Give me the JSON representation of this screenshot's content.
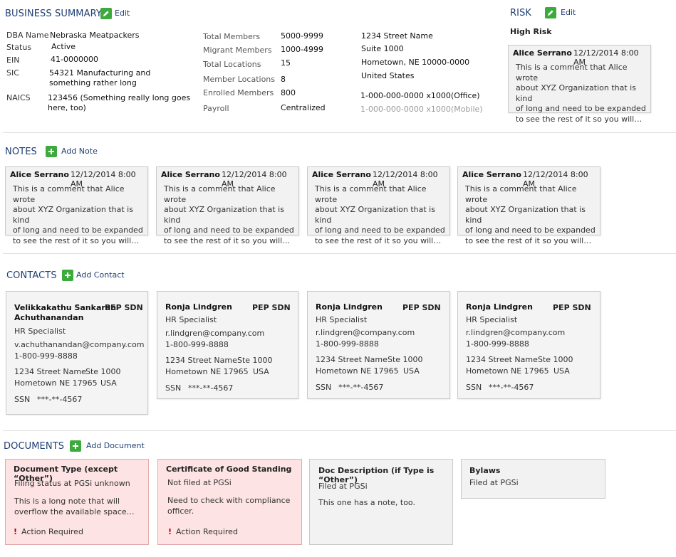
{
  "business": {
    "title": "BUSINESS SUMMARY",
    "edit_label": "Edit",
    "fields": {
      "dba_label": "DBA Name",
      "dba_value": "Nebraska Meatpackers",
      "status_label": "Status",
      "status_value": "Active",
      "ein_label": "EIN",
      "ein_value": "41-0000000",
      "sic_label": "SIC",
      "sic_value_1": "54321 Manufacturing and",
      "sic_value_2": "something rather long",
      "naics_label": "NAICS",
      "naics_value_1": "123456 (Something really long goes",
      "naics_value_2": "here, too)"
    },
    "stats": [
      {
        "label": "Total Members",
        "value": "5000-9999"
      },
      {
        "label": "Migrant Members",
        "value": "1000-4999"
      },
      {
        "label": "Total Locations",
        "value": "15"
      },
      {
        "label": "Member Locations",
        "value": "8"
      },
      {
        "label": "Enrolled Members",
        "value": "800"
      },
      {
        "label": "Payroll",
        "value": "Centralized"
      }
    ],
    "address": {
      "line1": "1234 Street Name",
      "line2": "Suite 1000",
      "line3": "Hometown, NE  10000-0000",
      "line4": "United States",
      "phone_office": "1-000-000-0000",
      "phone_office_ext": "x1000(Office)",
      "phone_mobile": "1-000-000-0000",
      "phone_mobile_ext": "x1000(Mobile)"
    }
  },
  "risk": {
    "title": "RISK",
    "edit_label": "Edit",
    "level": "High Risk",
    "comment": {
      "author": "Alice Serrano",
      "date": "12/12/2014 8:00 AM",
      "lines": [
        "This is a comment that Alice wrote",
        "about XYZ Organization that is kind",
        "of long and need to be expanded",
        "to see the rest of it so you will…"
      ]
    }
  },
  "notes": {
    "title": "NOTES",
    "add_label": "Add Note",
    "items": [
      {
        "author": "Alice Serrano",
        "date": "12/12/2014 8:00 AM",
        "lines": [
          "This is a comment that Alice wrote",
          "about XYZ Organization that is kind",
          "of long and need to be expanded",
          "to see the rest of it so you will…"
        ]
      },
      {
        "author": "Alice Serrano",
        "date": "12/12/2014 8:00 AM",
        "lines": [
          "This is a comment that Alice wrote",
          "about XYZ Organization that is kind",
          "of long and need to be expanded",
          "to see the rest of it so you will…"
        ]
      },
      {
        "author": "Alice Serrano",
        "date": "12/12/2014 8:00 AM",
        "lines": [
          "This is a comment that Alice wrote",
          "about XYZ Organization that is kind",
          "of long and need to be expanded",
          "to see the rest of it so you will…"
        ]
      },
      {
        "author": "Alice Serrano",
        "date": "12/12/2014 8:00 AM",
        "lines": [
          "This is a comment that Alice wrote",
          "about XYZ Organization that is kind",
          "of long and need to be expanded",
          "to see the rest of it so you will…"
        ]
      }
    ]
  },
  "contacts": {
    "title": "CONTACTS",
    "add_label": "Add Contact",
    "items": [
      {
        "name_1": "Velikkakathu Sankaran",
        "name_2": "Achuthanandan",
        "tag_pep": "PEP",
        "tag_sdn": "SDN",
        "role": "HR Specialist",
        "email": "v.achuthanandan@company.com",
        "phone": "1-800-999-8888",
        "street": "1234 Street Name",
        "suite": "Ste 1000",
        "city": "Hometown NE  17965",
        "country": "USA",
        "ssn_label": "SSN",
        "ssn": "***-**-4567"
      },
      {
        "name_1": "Ronja Lindgren",
        "name_2": "",
        "tag_pep": "PEP",
        "tag_sdn": "SDN",
        "role": "HR Specialist",
        "email": "r.lindgren@company.com",
        "phone": "1-800-999-8888",
        "street": "1234 Street Name",
        "suite": "Ste 1000",
        "city": "Hometown NE  17965",
        "country": "USA",
        "ssn_label": "SSN",
        "ssn": "***-**-4567"
      },
      {
        "name_1": "Ronja Lindgren",
        "name_2": "",
        "tag_pep": "PEP",
        "tag_sdn": "SDN",
        "role": "HR Specialist",
        "email": "r.lindgren@company.com",
        "phone": "1-800-999-8888",
        "street": "1234 Street Name",
        "suite": "Ste 1000",
        "city": "Hometown NE  17965",
        "country": "USA",
        "ssn_label": "SSN",
        "ssn": "***-**-4567"
      },
      {
        "name_1": "Ronja Lindgren",
        "name_2": "",
        "tag_pep": "PEP",
        "tag_sdn": "SDN",
        "role": "HR Specialist",
        "email": "r.lindgren@company.com",
        "phone": "1-800-999-8888",
        "street": "1234 Street Name",
        "suite": "Ste 1000",
        "city": "Hometown NE  17965",
        "country": "USA",
        "ssn_label": "SSN",
        "ssn": "***-**-4567"
      }
    ]
  },
  "documents": {
    "title": "DOCUMENTS",
    "add_label": "Add Document",
    "items": [
      {
        "title": "Document Type (except “Other”)",
        "status": "Filing status at PGSi unknown",
        "note_1": "This is a long note that  will",
        "note_2": "overflow the available space…",
        "action": "Action Required"
      },
      {
        "title": "Certificate of Good Standing",
        "status": "Not filed at PGSi",
        "note_1": "Need to check with compliance",
        "note_2": "officer.",
        "action": "Action Required"
      },
      {
        "title": "Doc Description (if Type is “Other”)",
        "status": "Filed at PGSi",
        "note_1": "This one has a note, too."
      },
      {
        "title": "Bylaws",
        "status": "Filed at PGSi"
      }
    ]
  },
  "colors": {
    "accent": "#1f3f73",
    "add_green": "#3daa3d",
    "alert_bg": "#fde3e3",
    "alert_icon": "#b00000"
  },
  "icons": {
    "edit": "pencil-icon",
    "add": "plus-icon",
    "alert": "exclamation-icon"
  }
}
